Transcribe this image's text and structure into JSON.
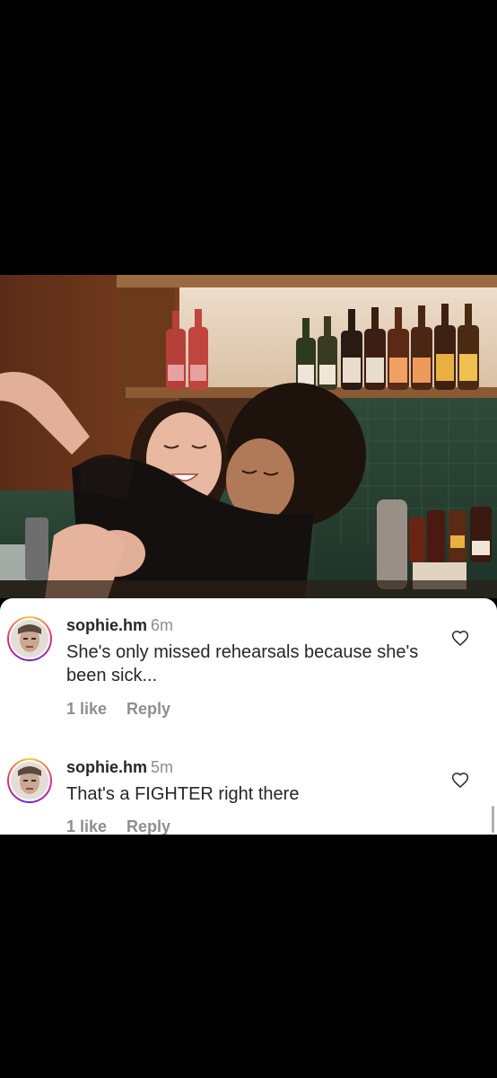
{
  "comments": [
    {
      "username": "sophie.hm",
      "time": "6m",
      "text": "She's only missed rehearsals because she's been sick...",
      "likes": "1 like",
      "reply": "Reply"
    },
    {
      "username": "sophie.hm",
      "time": "5m",
      "text": "That's a FIGHTER right there",
      "likes": "1 like",
      "reply": "Reply"
    }
  ],
  "colors": {
    "background": "#000000",
    "card": "#ffffff",
    "text": "#262626",
    "muted": "#8e8e8e"
  },
  "icons": [
    "heart-outline-icon",
    "avatar-story-ring"
  ]
}
